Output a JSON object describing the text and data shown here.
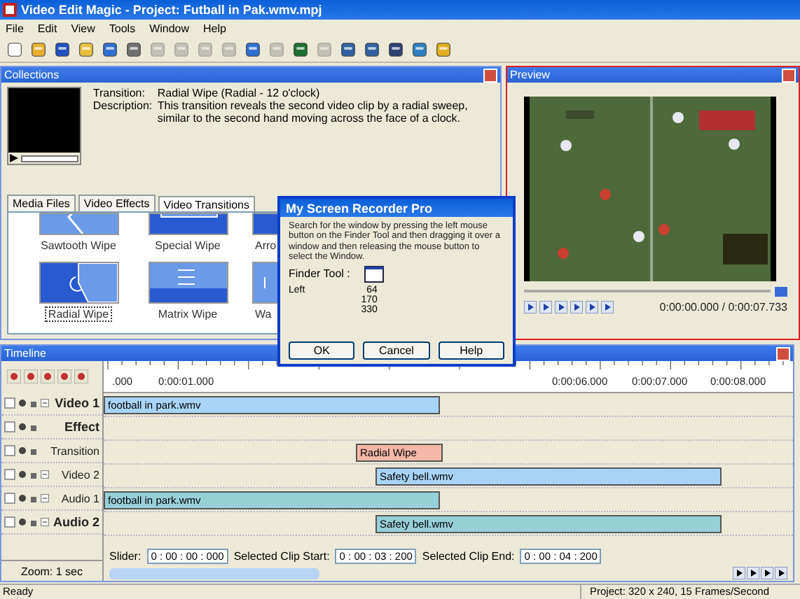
{
  "window": {
    "title": "Video Edit Magic - Project: Futball in Pak.wmv.mpj"
  },
  "menu": [
    "File",
    "Edit",
    "View",
    "Tools",
    "Window",
    "Help"
  ],
  "toolbar": [
    {
      "disabled": false
    },
    {
      "disabled": false
    },
    {
      "disabled": false
    },
    {
      "disabled": false
    },
    {
      "disabled": false
    },
    {
      "disabled": false
    },
    {
      "disabled": true
    },
    {
      "disabled": true
    },
    {
      "disabled": true
    },
    {
      "disabled": true
    },
    {
      "disabled": false
    },
    {
      "disabled": true
    },
    {
      "disabled": false
    },
    {
      "disabled": true
    },
    {
      "disabled": false
    },
    {
      "disabled": false
    },
    {
      "disabled": false
    },
    {
      "disabled": false
    },
    {
      "disabled": false
    }
  ],
  "collections": {
    "title": "Collections",
    "transition_label": "Transition:",
    "transition_value": "Radial Wipe (Radial - 12 o'clock)",
    "description_label": "Description:",
    "description_value": "This transition reveals the second video clip by a radial sweep, similar to the second hand moving across the face of a clock.",
    "tabs": [
      {
        "label": "Media Files",
        "selected": false
      },
      {
        "label": "Video Effects",
        "selected": false
      },
      {
        "label": "Video Transitions",
        "selected": true
      }
    ],
    "tiles": [
      {
        "label": "Sawtooth Wipe",
        "selected": false
      },
      {
        "label": "Special Wipe",
        "selected": false
      },
      {
        "label": "Arro",
        "selected": false
      },
      {
        "label": "Radial Wipe",
        "selected": true
      },
      {
        "label": "Matrix Wipe",
        "selected": false
      },
      {
        "label": "Wa",
        "selected": false
      }
    ]
  },
  "preview": {
    "title": "Preview",
    "time": "0:00:00.000 / 0:00:07.733"
  },
  "timeline": {
    "title": "Timeline",
    "ruler": [
      ".000",
      "0:00:01.000",
      "0:00:06.000",
      "0:00:07.000",
      "0:00:08.000"
    ],
    "tracks": [
      {
        "label": "Video 1",
        "kind": "video",
        "bold": true,
        "checked": false,
        "clips": [
          "football in park.wmv"
        ]
      },
      {
        "label": "Effect",
        "kind": "effect",
        "bold": true,
        "checked": false
      },
      {
        "label": "Transition",
        "kind": "transition",
        "bold": false,
        "checked": false,
        "clips": [
          "Radial Wipe"
        ]
      },
      {
        "label": "Video 2",
        "kind": "video",
        "bold": false,
        "checked": false,
        "clips": [
          "Safety bell.wmv"
        ]
      },
      {
        "label": "Audio 1",
        "kind": "audio",
        "bold": false,
        "checked": false,
        "clips": [
          "football in park.wmv"
        ]
      },
      {
        "label": "Audio 2",
        "kind": "audio",
        "bold": true,
        "checked": false,
        "clips": [
          "Safety bell.wmv"
        ]
      }
    ],
    "slider_label": "Slider:",
    "slider_value": "0 : 00 : 00 : 000",
    "clip_start_label": "Selected Clip Start:",
    "clip_start_value": "0 : 00 : 03 : 200",
    "clip_end_label": "Selected Clip End:",
    "clip_end_value": "0 : 00 : 04 : 200",
    "zoom": "Zoom: 1 sec"
  },
  "dialog": {
    "title": "My Screen Recorder Pro",
    "text": "Search for the window by pressing the left mouse button on the Finder Tool and then dragging it over a window and then releasing the mouse button to select the Window.",
    "finder_label": "Finder Tool :",
    "field_labels": [
      "Left"
    ],
    "field_values": [
      "64",
      "170",
      "330"
    ],
    "buttons": [
      "OK",
      "Cancel",
      "Help"
    ]
  },
  "status_bar": {
    "left": "Ready",
    "right": "Project: 320 x 240, 15 Frames/Second"
  }
}
